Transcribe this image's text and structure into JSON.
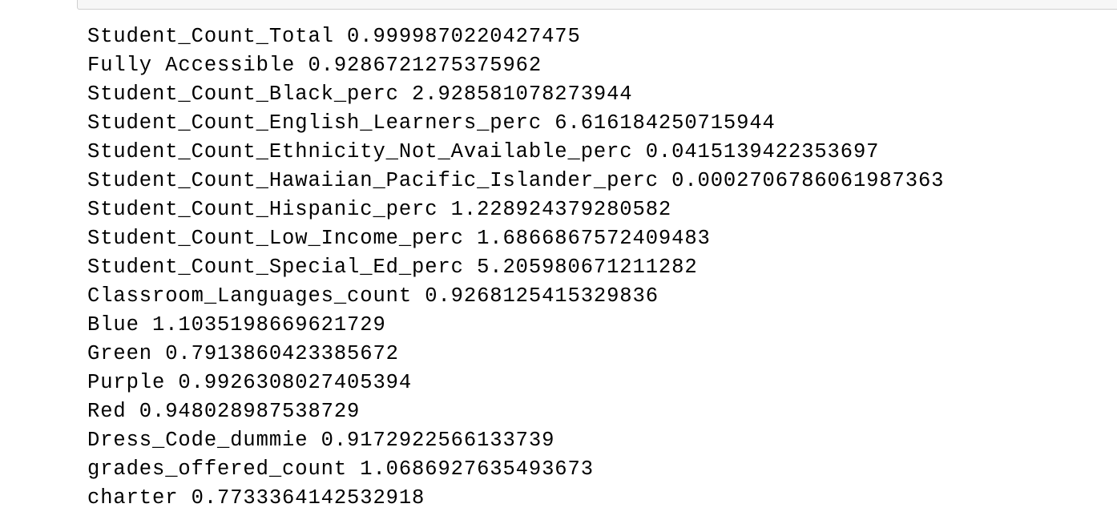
{
  "output": {
    "lines": [
      "Student_Count_Total 0.9999870220427475",
      "Fully Accessible 0.9286721275375962",
      "Student_Count_Black_perc 2.928581078273944",
      "Student_Count_English_Learners_perc 6.616184250715944",
      "Student_Count_Ethnicity_Not_Available_perc 0.0415139422353697",
      "Student_Count_Hawaiian_Pacific_Islander_perc 0.0002706786061987363",
      "Student_Count_Hispanic_perc 1.228924379280582",
      "Student_Count_Low_Income_perc 1.6866867572409483",
      "Student_Count_Special_Ed_perc 5.205980671211282",
      "Classroom_Languages_count 0.9268125415329836",
      "Blue 1.1035198669621729",
      "Green 0.7913860423385672",
      "Purple 0.9926308027405394",
      "Red 0.948028987538729",
      "Dress_Code_dummie 0.9172922566133739",
      "grades_offered_count 1.0686927635493673",
      "charter 0.7733364142532918"
    ]
  }
}
